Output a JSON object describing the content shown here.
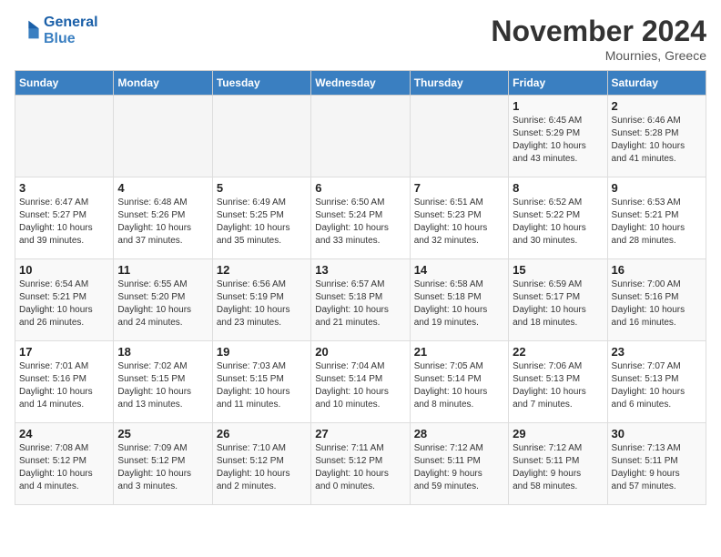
{
  "header": {
    "logo_line1": "General",
    "logo_line2": "Blue",
    "month_title": "November 2024",
    "location": "Mournies, Greece"
  },
  "days_of_week": [
    "Sunday",
    "Monday",
    "Tuesday",
    "Wednesday",
    "Thursday",
    "Friday",
    "Saturday"
  ],
  "weeks": [
    [
      {
        "day": "",
        "info": ""
      },
      {
        "day": "",
        "info": ""
      },
      {
        "day": "",
        "info": ""
      },
      {
        "day": "",
        "info": ""
      },
      {
        "day": "",
        "info": ""
      },
      {
        "day": "1",
        "info": "Sunrise: 6:45 AM\nSunset: 5:29 PM\nDaylight: 10 hours\nand 43 minutes."
      },
      {
        "day": "2",
        "info": "Sunrise: 6:46 AM\nSunset: 5:28 PM\nDaylight: 10 hours\nand 41 minutes."
      }
    ],
    [
      {
        "day": "3",
        "info": "Sunrise: 6:47 AM\nSunset: 5:27 PM\nDaylight: 10 hours\nand 39 minutes."
      },
      {
        "day": "4",
        "info": "Sunrise: 6:48 AM\nSunset: 5:26 PM\nDaylight: 10 hours\nand 37 minutes."
      },
      {
        "day": "5",
        "info": "Sunrise: 6:49 AM\nSunset: 5:25 PM\nDaylight: 10 hours\nand 35 minutes."
      },
      {
        "day": "6",
        "info": "Sunrise: 6:50 AM\nSunset: 5:24 PM\nDaylight: 10 hours\nand 33 minutes."
      },
      {
        "day": "7",
        "info": "Sunrise: 6:51 AM\nSunset: 5:23 PM\nDaylight: 10 hours\nand 32 minutes."
      },
      {
        "day": "8",
        "info": "Sunrise: 6:52 AM\nSunset: 5:22 PM\nDaylight: 10 hours\nand 30 minutes."
      },
      {
        "day": "9",
        "info": "Sunrise: 6:53 AM\nSunset: 5:21 PM\nDaylight: 10 hours\nand 28 minutes."
      }
    ],
    [
      {
        "day": "10",
        "info": "Sunrise: 6:54 AM\nSunset: 5:21 PM\nDaylight: 10 hours\nand 26 minutes."
      },
      {
        "day": "11",
        "info": "Sunrise: 6:55 AM\nSunset: 5:20 PM\nDaylight: 10 hours\nand 24 minutes."
      },
      {
        "day": "12",
        "info": "Sunrise: 6:56 AM\nSunset: 5:19 PM\nDaylight: 10 hours\nand 23 minutes."
      },
      {
        "day": "13",
        "info": "Sunrise: 6:57 AM\nSunset: 5:18 PM\nDaylight: 10 hours\nand 21 minutes."
      },
      {
        "day": "14",
        "info": "Sunrise: 6:58 AM\nSunset: 5:18 PM\nDaylight: 10 hours\nand 19 minutes."
      },
      {
        "day": "15",
        "info": "Sunrise: 6:59 AM\nSunset: 5:17 PM\nDaylight: 10 hours\nand 18 minutes."
      },
      {
        "day": "16",
        "info": "Sunrise: 7:00 AM\nSunset: 5:16 PM\nDaylight: 10 hours\nand 16 minutes."
      }
    ],
    [
      {
        "day": "17",
        "info": "Sunrise: 7:01 AM\nSunset: 5:16 PM\nDaylight: 10 hours\nand 14 minutes."
      },
      {
        "day": "18",
        "info": "Sunrise: 7:02 AM\nSunset: 5:15 PM\nDaylight: 10 hours\nand 13 minutes."
      },
      {
        "day": "19",
        "info": "Sunrise: 7:03 AM\nSunset: 5:15 PM\nDaylight: 10 hours\nand 11 minutes."
      },
      {
        "day": "20",
        "info": "Sunrise: 7:04 AM\nSunset: 5:14 PM\nDaylight: 10 hours\nand 10 minutes."
      },
      {
        "day": "21",
        "info": "Sunrise: 7:05 AM\nSunset: 5:14 PM\nDaylight: 10 hours\nand 8 minutes."
      },
      {
        "day": "22",
        "info": "Sunrise: 7:06 AM\nSunset: 5:13 PM\nDaylight: 10 hours\nand 7 minutes."
      },
      {
        "day": "23",
        "info": "Sunrise: 7:07 AM\nSunset: 5:13 PM\nDaylight: 10 hours\nand 6 minutes."
      }
    ],
    [
      {
        "day": "24",
        "info": "Sunrise: 7:08 AM\nSunset: 5:12 PM\nDaylight: 10 hours\nand 4 minutes."
      },
      {
        "day": "25",
        "info": "Sunrise: 7:09 AM\nSunset: 5:12 PM\nDaylight: 10 hours\nand 3 minutes."
      },
      {
        "day": "26",
        "info": "Sunrise: 7:10 AM\nSunset: 5:12 PM\nDaylight: 10 hours\nand 2 minutes."
      },
      {
        "day": "27",
        "info": "Sunrise: 7:11 AM\nSunset: 5:12 PM\nDaylight: 10 hours\nand 0 minutes."
      },
      {
        "day": "28",
        "info": "Sunrise: 7:12 AM\nSunset: 5:11 PM\nDaylight: 9 hours\nand 59 minutes."
      },
      {
        "day": "29",
        "info": "Sunrise: 7:12 AM\nSunset: 5:11 PM\nDaylight: 9 hours\nand 58 minutes."
      },
      {
        "day": "30",
        "info": "Sunrise: 7:13 AM\nSunset: 5:11 PM\nDaylight: 9 hours\nand 57 minutes."
      }
    ]
  ]
}
